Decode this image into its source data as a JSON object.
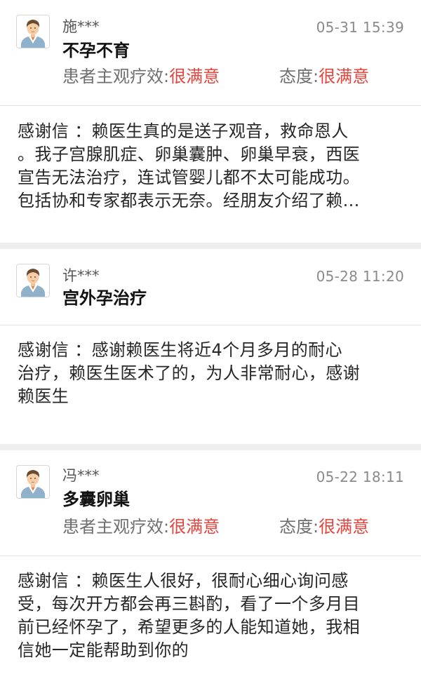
{
  "reviews": [
    {
      "user_name": "施***",
      "timestamp": "05-31 15:39",
      "title": "不孕不育",
      "efficacy_label": "患者主观疗效:",
      "efficacy_value": "很满意",
      "attitude_label": "态度:",
      "attitude_value": "很满意",
      "body_lines": [
        "感谢信 ：赖医生真的是送子观音，救命恩人",
        "。我子宫腺肌症、卵巢囊肿、卵巢早衰，西医",
        "宣告无法治疗，连试管婴儿都不太可能成功。",
        "包括协和专家都表示无奈。经朋友介绍了赖..."
      ]
    },
    {
      "user_name": "许***",
      "timestamp": "05-28 11:20",
      "title": "宫外孕治疗",
      "body_lines": [
        "感谢信 ：感谢赖医生将近4个月多月的耐心",
        "治疗，赖医生医术了的，为人非常耐心，感谢",
        "赖医生"
      ]
    },
    {
      "user_name": "冯***",
      "timestamp": "05-22 18:11",
      "title": "多囊卵巢",
      "efficacy_label": "患者主观疗效:",
      "efficacy_value": "很满意",
      "attitude_label": "态度:",
      "attitude_value": "很满意",
      "body_lines": [
        "感谢信 ：赖医生人很好，很耐心细心询问感",
        "受，每次开方都会再三斟酌，看了一个多月目",
        "前已经怀孕了，希望更多的人能知道她，我相",
        "信她一定能帮助到你的"
      ]
    }
  ],
  "colors": {
    "rating_value": "#e4453c",
    "separator": "#eeeeee"
  },
  "icons": {
    "avatar": "user-avatar-icon"
  }
}
